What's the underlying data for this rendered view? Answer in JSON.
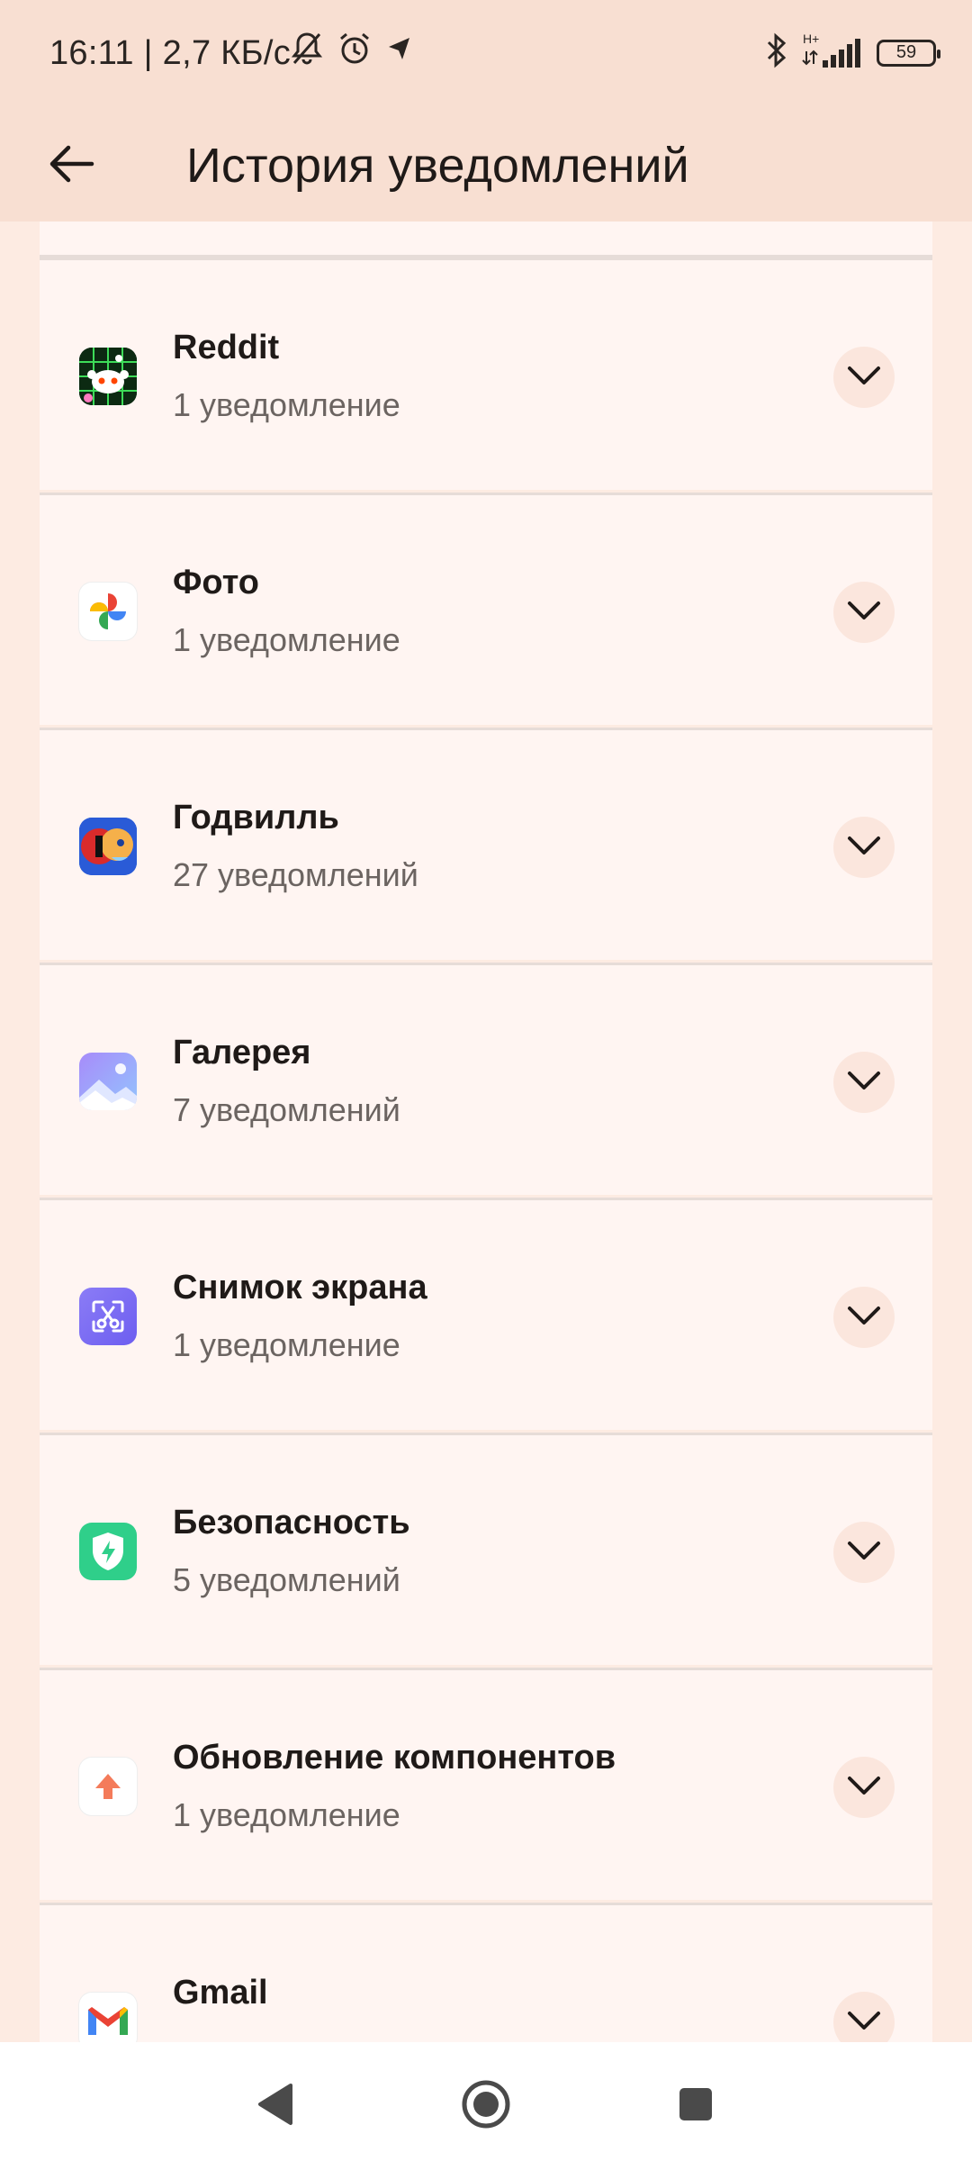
{
  "status": {
    "time": "16:11 | 2,7 КБ/с",
    "network": "H+",
    "battery": "59"
  },
  "appbar": {
    "title": "История уведомлений"
  },
  "apps": [
    {
      "name": "Reddit",
      "count": "1 уведомление",
      "icon": "reddit-icon"
    },
    {
      "name": "Фото",
      "count": "1 уведомление",
      "icon": "google-photos-icon"
    },
    {
      "name": "Годвилль",
      "count": "27 уведомлений",
      "icon": "godville-icon"
    },
    {
      "name": "Галерея",
      "count": "7 уведомлений",
      "icon": "gallery-icon"
    },
    {
      "name": "Снимок экрана",
      "count": "1 уведомление",
      "icon": "screenshot-icon"
    },
    {
      "name": "Безопасность",
      "count": "5 уведомлений",
      "icon": "security-icon"
    },
    {
      "name": "Обновление компонентов",
      "count": "1 уведомление",
      "icon": "component-update-icon"
    },
    {
      "name": "Gmail",
      "count": "",
      "icon": "gmail-icon"
    }
  ],
  "colors": {
    "background": "#FDEBE2",
    "header": "#F8DFD2",
    "card": "#FFF5F2",
    "divider": "#E6DCD8"
  }
}
